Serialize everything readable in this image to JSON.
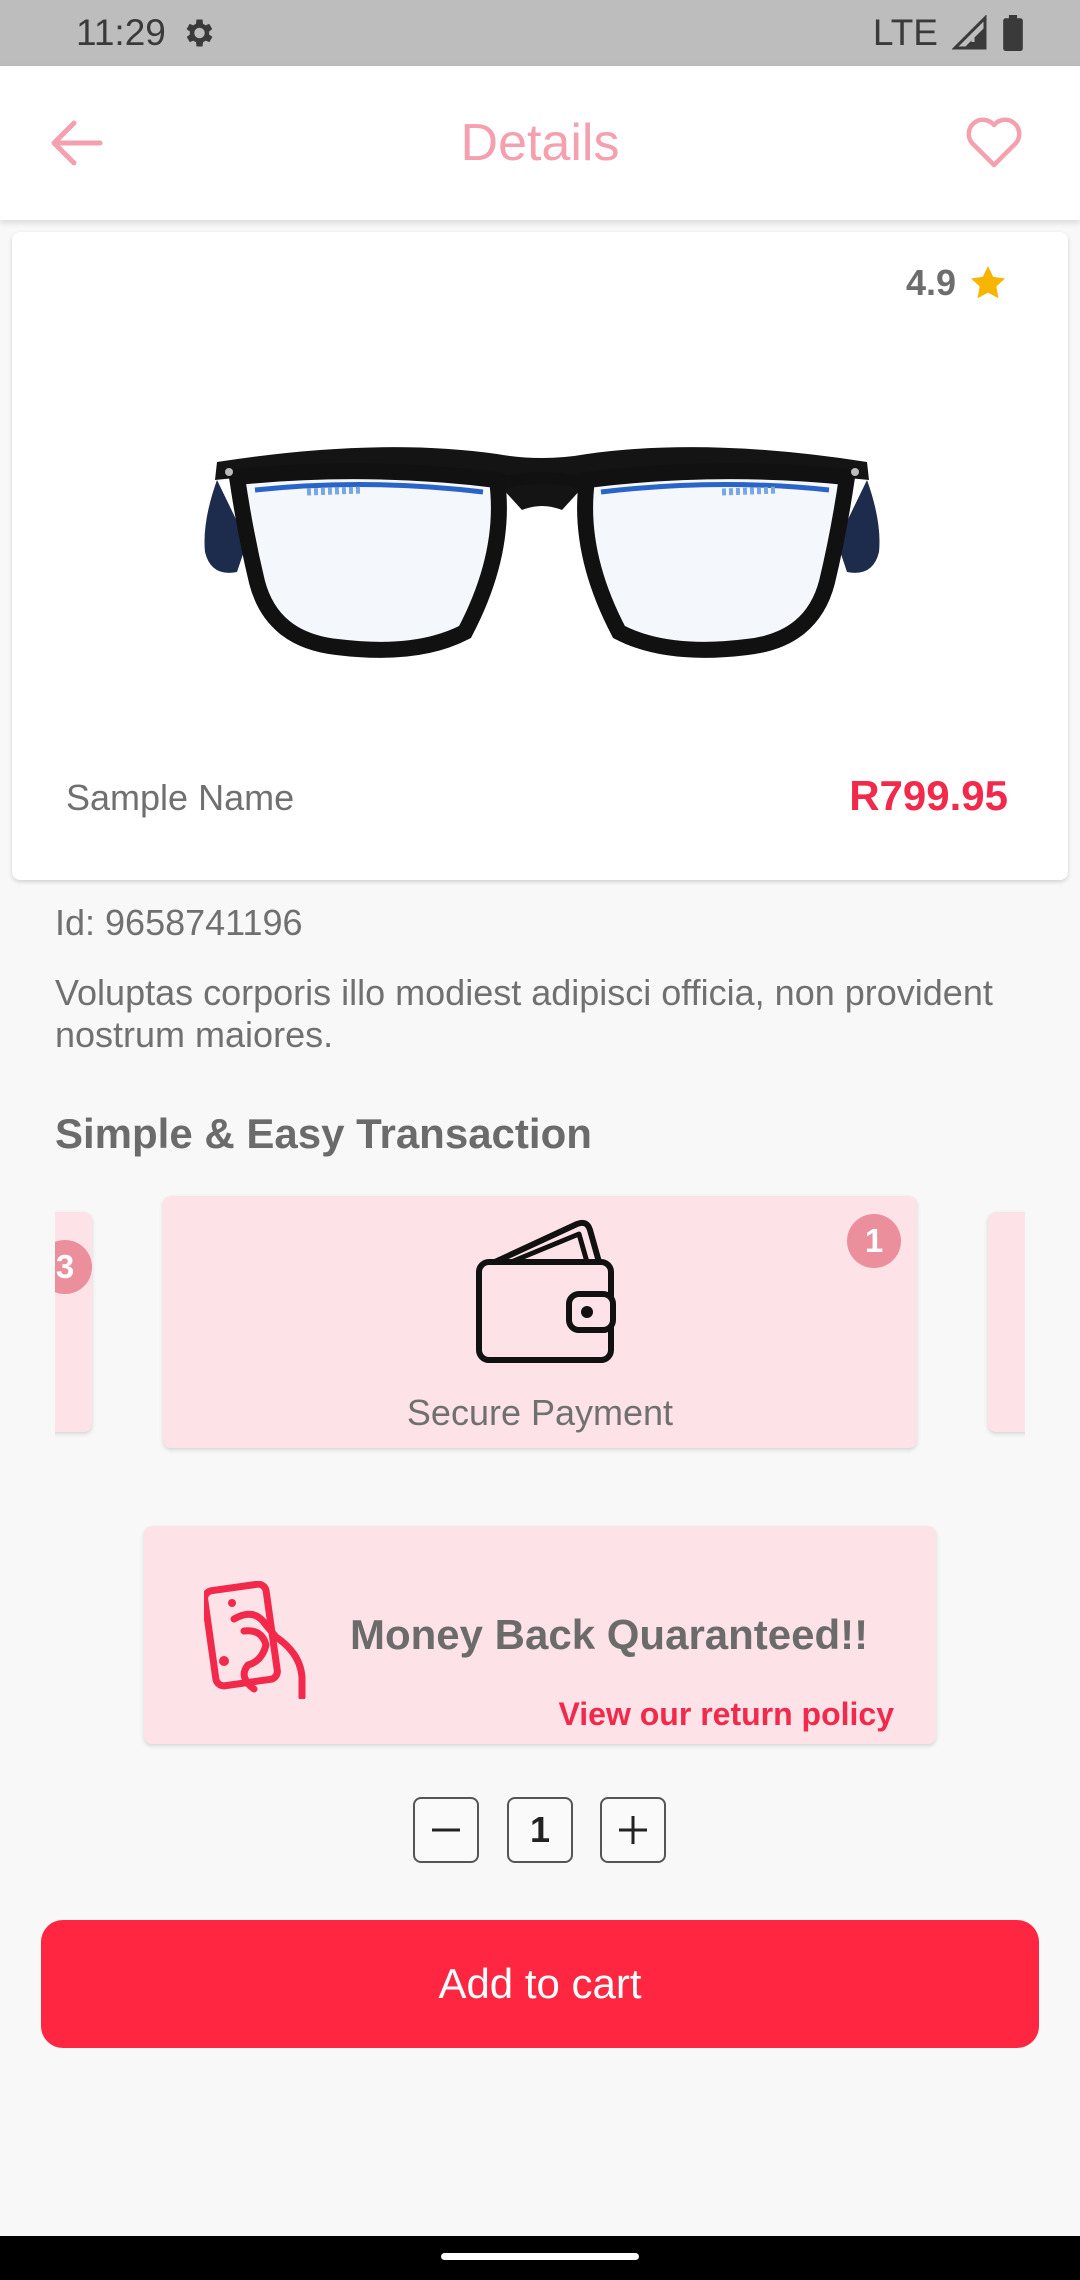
{
  "status_bar": {
    "time": "11:29",
    "network": "LTE"
  },
  "header": {
    "title": "Details"
  },
  "product": {
    "rating": "4.9",
    "name": "Sample Name",
    "price": "R799.95",
    "id_text": "Id: 9658741196",
    "description": "Voluptas corporis illo modiest adipisci officia, non provident nostrum maiores."
  },
  "transactions": {
    "section_title": "Simple & Easy Transaction",
    "cards": [
      {
        "badge": "3"
      },
      {
        "badge": "1",
        "label": "Secure Payment"
      }
    ]
  },
  "money_back": {
    "title": "Money Back Quaranteed!!",
    "link": "View our return policy"
  },
  "quantity": {
    "value": "1"
  },
  "actions": {
    "add_to_cart": "Add to cart"
  },
  "colors": {
    "accent": "#fe2640",
    "price": "#f2294a",
    "header_title": "#f4a0ae",
    "card_bg": "#fde3e7",
    "badge": "#ec8f9c",
    "star": "#f7b500"
  }
}
